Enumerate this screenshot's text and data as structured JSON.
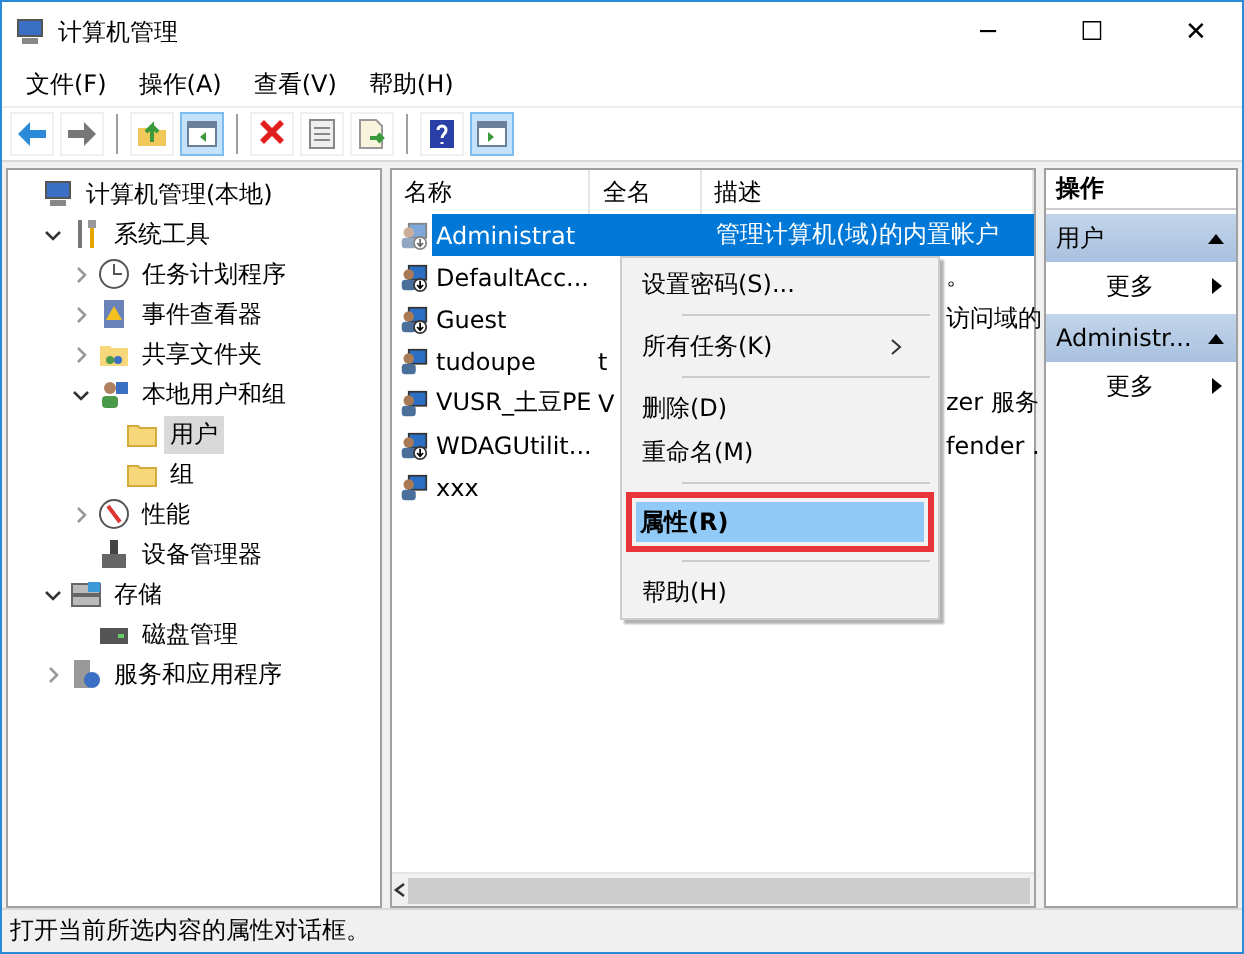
{
  "window": {
    "title": "计算机管理",
    "controls": [
      "─",
      "☐",
      "✕"
    ]
  },
  "menu_bar": [
    "文件(F)",
    "操作(A)",
    "查看(V)",
    "帮助(H)"
  ],
  "toolbar": [
    {
      "kind": "back",
      "on": false
    },
    {
      "kind": "forward",
      "on": false
    },
    {
      "kind": "sep"
    },
    {
      "kind": "up",
      "on": false
    },
    {
      "kind": "tree",
      "on": true
    },
    {
      "kind": "sep"
    },
    {
      "kind": "delete",
      "on": false
    },
    {
      "kind": "properties",
      "on": false
    },
    {
      "kind": "export",
      "on": false
    },
    {
      "kind": "sep"
    },
    {
      "kind": "help",
      "on": false
    },
    {
      "kind": "pane",
      "on": true
    }
  ],
  "tree": [
    {
      "label": "计算机管理(本地)",
      "selected": false,
      "children": [
        {
          "label": "系统工具",
          "expanded": true,
          "selected": false,
          "children": [
            {
              "label": "任务计划程序",
              "expanded": false,
              "selected": false
            },
            {
              "label": "事件查看器",
              "expanded": false,
              "selected": false
            },
            {
              "label": "共享文件夹",
              "expanded": false,
              "selected": false
            },
            {
              "label": "本地用户和组",
              "expanded": true,
              "selected": false,
              "children": [
                {
                  "label": "用户",
                  "selected": true
                },
                {
                  "label": "组",
                  "selected": false
                }
              ]
            },
            {
              "label": "性能",
              "expanded": false,
              "selected": false
            },
            {
              "label": "设备管理器",
              "selected": false
            }
          ]
        },
        {
          "label": "存储",
          "expanded": true,
          "selected": false,
          "children": [
            {
              "label": "磁盘管理",
              "selected": false
            }
          ]
        },
        {
          "label": "服务和应用程序",
          "expanded": false,
          "selected": false
        }
      ]
    }
  ],
  "table": {
    "columns": [
      "名称",
      "全名",
      "描述"
    ],
    "rows": [
      {
        "name": "Administrat",
        "full_name": "",
        "description": "管理计算机(域)的内置帐户",
        "disabled": true,
        "selected": true
      },
      {
        "name": "DefaultAcc...",
        "full_name": "",
        "description": "。",
        "disabled": true,
        "selected": false
      },
      {
        "name": "Guest",
        "full_name": "",
        "description": "访问域的",
        "disabled": true,
        "selected": false
      },
      {
        "name": "tudoupe",
        "full_name": "t",
        "description": "",
        "disabled": false,
        "selected": false
      },
      {
        "name": "VUSR_土豆PE",
        "full_name": "V",
        "description": "zer 服务",
        "disabled": false,
        "selected": false
      },
      {
        "name": "WDAGUtilit...",
        "full_name": "",
        "description": "fender .",
        "disabled": true,
        "selected": false
      },
      {
        "name": "xxx",
        "full_name": "",
        "description": "",
        "disabled": false,
        "selected": false
      }
    ]
  },
  "context_menu": [
    {
      "kind": "item",
      "label": "设置密码(S)...",
      "submenu": false,
      "selected": false,
      "default": false,
      "highlighted_box": false
    },
    {
      "kind": "separator"
    },
    {
      "kind": "item",
      "label": "所有任务(K)",
      "submenu": true,
      "selected": false,
      "default": false,
      "highlighted_box": false
    },
    {
      "kind": "separator"
    },
    {
      "kind": "item",
      "label": "删除(D)",
      "submenu": false,
      "selected": false,
      "default": false,
      "highlighted_box": false
    },
    {
      "kind": "item",
      "label": "重命名(M)",
      "submenu": false,
      "selected": false,
      "default": false,
      "highlighted_box": false
    },
    {
      "kind": "separator"
    },
    {
      "kind": "item",
      "label": "属性(R)",
      "submenu": false,
      "selected": true,
      "default": true,
      "highlighted_box": true
    },
    {
      "kind": "separator"
    },
    {
      "kind": "item",
      "label": "帮助(H)",
      "submenu": false,
      "selected": false,
      "default": false,
      "highlighted_box": false
    }
  ],
  "actions": {
    "title": "操作",
    "sections": [
      {
        "title": "用户",
        "expanded": true,
        "items": [
          "更多"
        ]
      },
      {
        "title": "Administr...",
        "expanded": true,
        "items": [
          "更多"
        ]
      }
    ]
  },
  "status_bar": "打开当前所选内容的属性对话框。"
}
